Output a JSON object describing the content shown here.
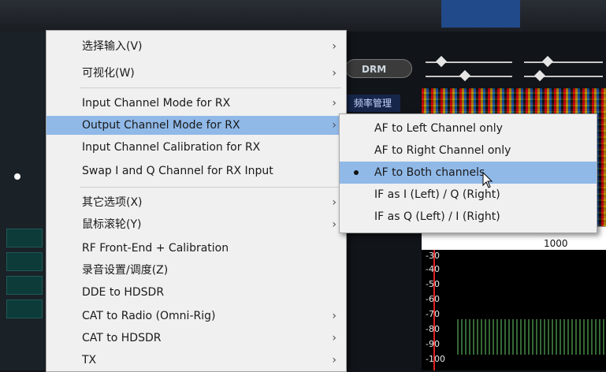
{
  "background": {
    "drm_label": "DRM",
    "freq_mgmt_label": "频率管理",
    "freq_axis_label": "1000",
    "db_scale": [
      "-30",
      "-40",
      "-50",
      "-60",
      "-70",
      "-80",
      "-90",
      "-100"
    ],
    "colors": {
      "accent_red": "#e02020",
      "waterfall_bg": "#2b1a10"
    }
  },
  "context_menu": {
    "items": [
      {
        "label": "选择输入(V)",
        "has_submenu": true
      },
      {
        "label": "可视化(W)",
        "has_submenu": true
      },
      {
        "label": "Input Channel Mode for RX",
        "has_submenu": true
      },
      {
        "label": "Output Channel Mode for RX",
        "has_submenu": true,
        "highlighted": true
      },
      {
        "label": "Input Channel Calibration for RX",
        "has_submenu": false
      },
      {
        "label": "Swap I and Q Channel for RX Input",
        "has_submenu": false
      },
      {
        "label": "其它选项(X)",
        "has_submenu": true
      },
      {
        "label": "鼠标滚轮(Y)",
        "has_submenu": true
      },
      {
        "label": "RF Front-End + Calibration",
        "has_submenu": false
      },
      {
        "label": "录音设置/调度(Z)",
        "has_submenu": false
      },
      {
        "label": "DDE to HDSDR",
        "has_submenu": false
      },
      {
        "label": "CAT to Radio (Omni-Rig)",
        "has_submenu": true
      },
      {
        "label": "CAT to HDSDR",
        "has_submenu": true
      },
      {
        "label": "TX",
        "has_submenu": true
      }
    ],
    "arrow_glyph": "›",
    "highlight_color": "#90b9e8"
  },
  "submenu": {
    "items": [
      {
        "label": "AF to Left Channel only",
        "selected": false
      },
      {
        "label": "AF to Right Channel only",
        "selected": false
      },
      {
        "label": "AF to Both channels",
        "selected": true
      },
      {
        "label": "IF as I (Left) / Q (Right)",
        "selected": false
      },
      {
        "label": "IF as Q (Left) / I (Right)",
        "selected": false
      }
    ]
  },
  "cursor": {
    "icon": "mouse-pointer-icon"
  }
}
